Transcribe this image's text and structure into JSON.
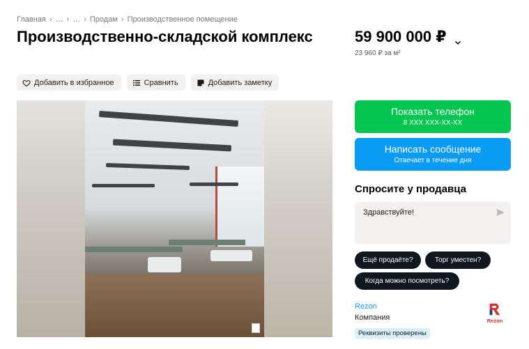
{
  "breadcrumbs": {
    "items": [
      "Главная",
      "…",
      "…",
      "Продам",
      "Производственное помещение"
    ]
  },
  "listing": {
    "title": "Производственно-складской комплекс",
    "price": "59 900 000 ₽",
    "price_per_m2": "23 960 ₽ за м²"
  },
  "actions": {
    "favorite_label": "Добавить в избранное",
    "compare_label": "Сравнить",
    "note_label": "Добавить заметку"
  },
  "contact": {
    "phone_label": "Показать телефон",
    "phone_masked": "8 XXX XXX-XX-XX",
    "message_label": "Написать сообщение",
    "message_sub": "Отвечает в течение дня"
  },
  "ask": {
    "title": "Спросите у продавца",
    "input_value": "Здравствуйте!",
    "chips": [
      "Ещё продаёте?",
      "Торг уместен?",
      "Когда можно посмотреть?"
    ]
  },
  "seller": {
    "name": "Rezon",
    "type": "Компания",
    "badge": "Реквизиты проверены",
    "logo_text": "Rezon"
  },
  "colors": {
    "accent_green": "#02c650",
    "accent_blue": "#0a9cf5",
    "chip_dark": "#0f1721",
    "badge_bg": "#d7f0fc",
    "logo_red": "#d2322d"
  }
}
